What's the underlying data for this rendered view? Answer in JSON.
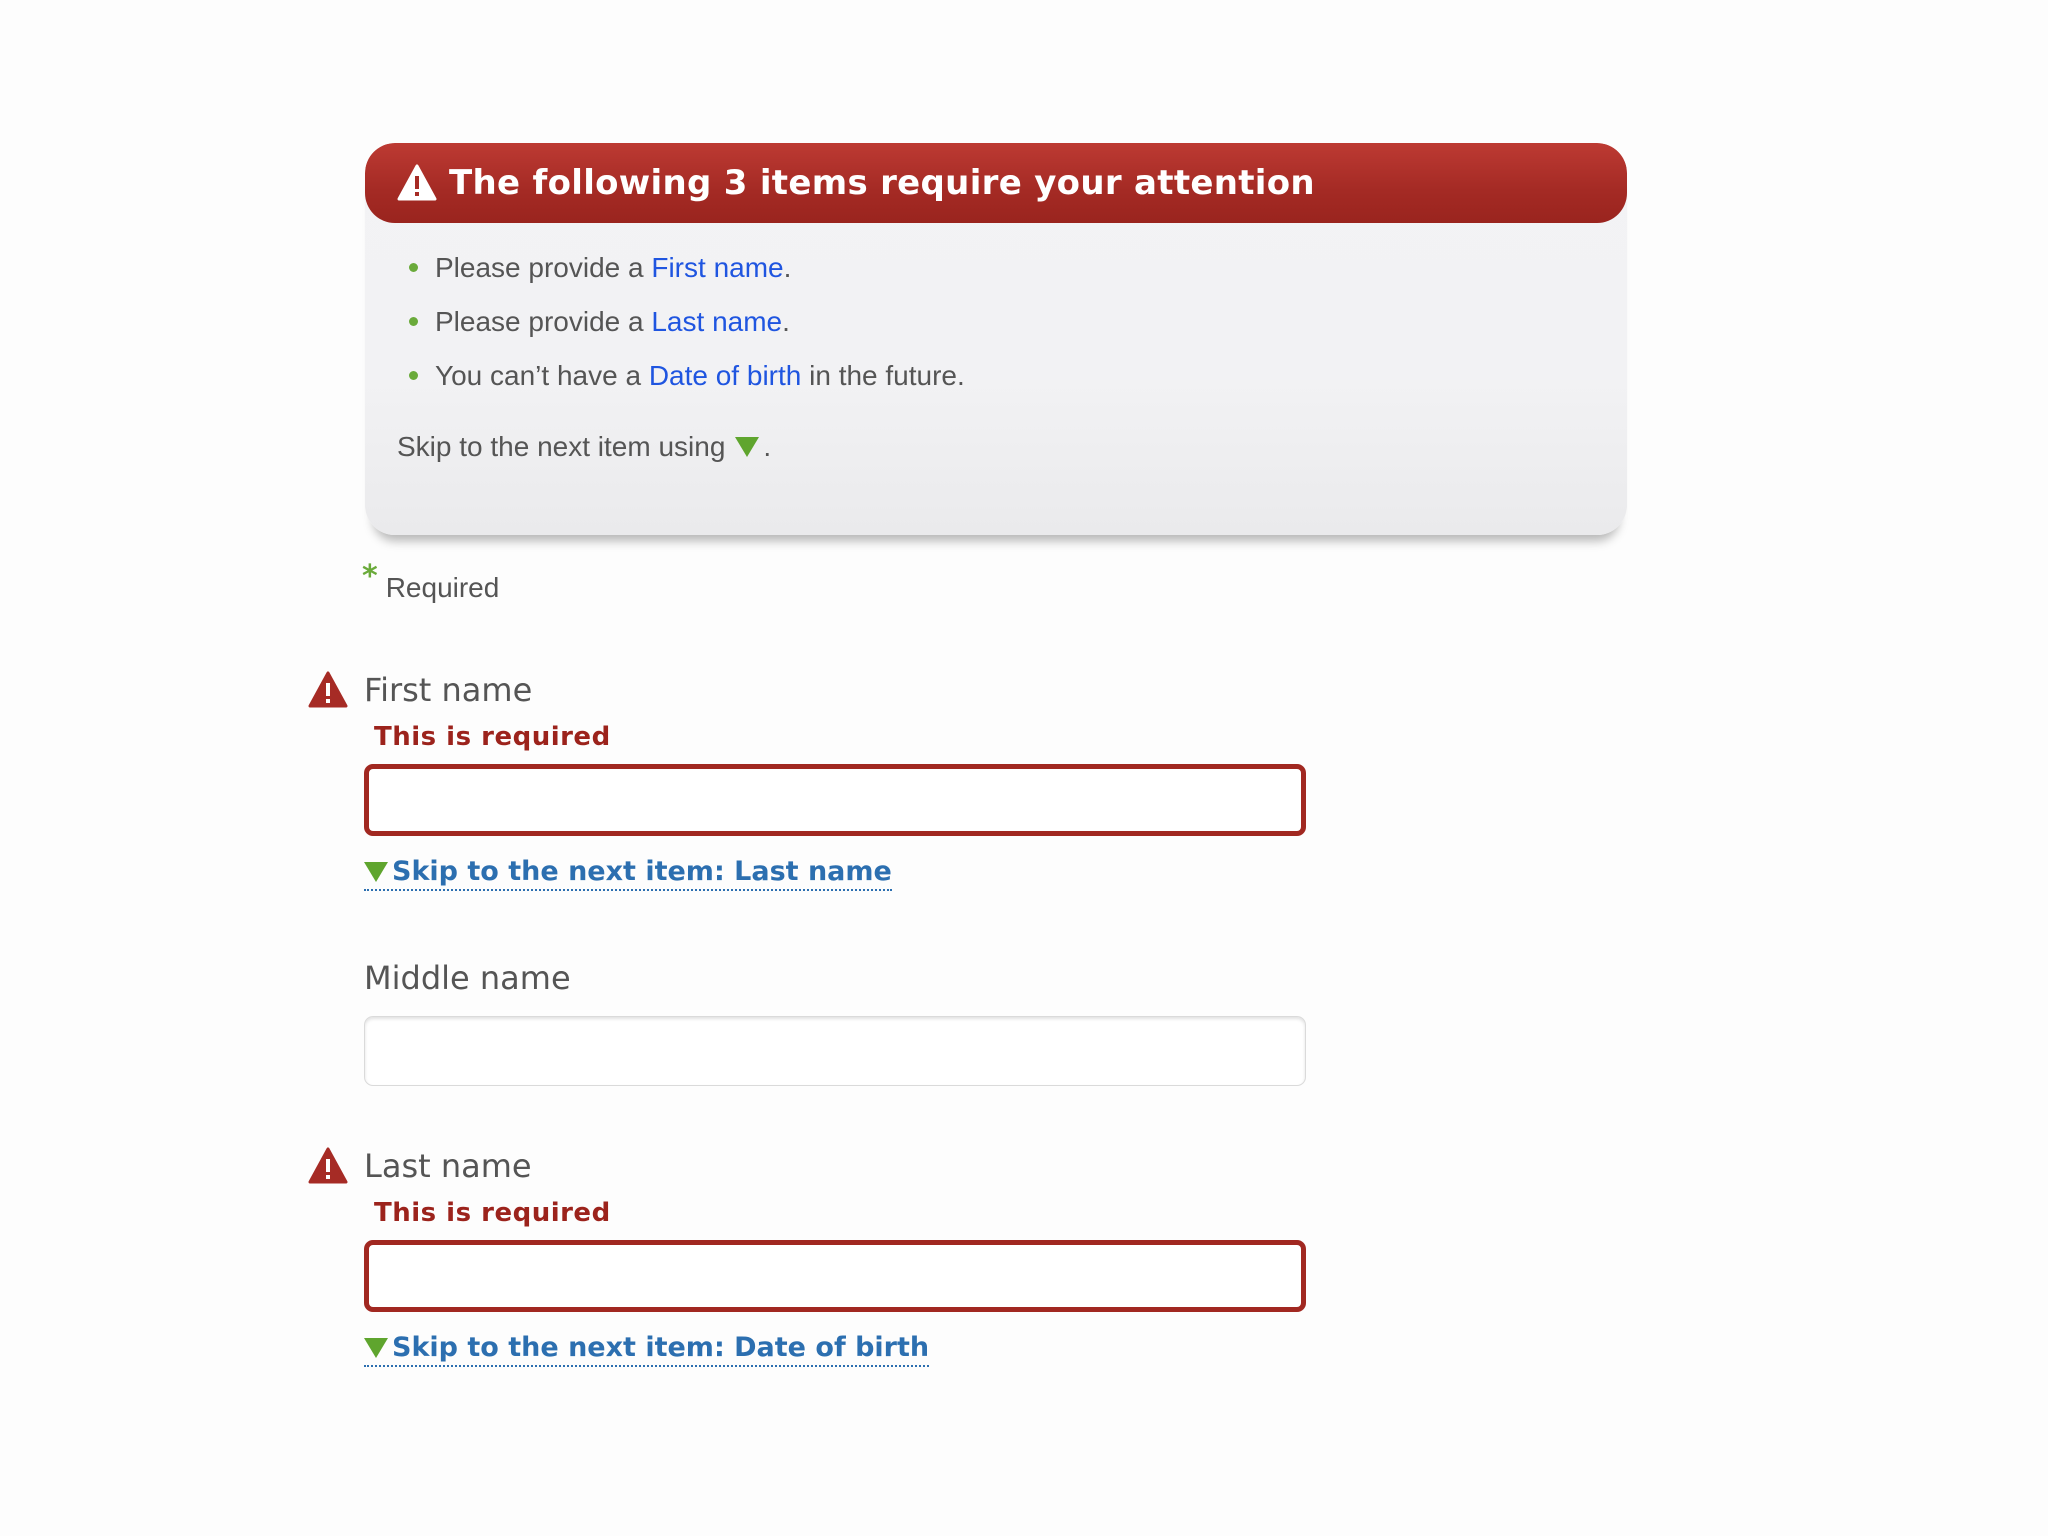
{
  "summary": {
    "title": "The following 3 items require your attention",
    "items": [
      {
        "prefix": "Please provide a ",
        "link": "First name",
        "suffix": "."
      },
      {
        "prefix": "Please provide a ",
        "link": "Last name",
        "suffix": "."
      },
      {
        "prefix": "You can’t have a ",
        "link": "Date of birth",
        "suffix": " in the future."
      }
    ],
    "skip_note_prefix": "Skip to the next item using",
    "skip_note_suffix": "."
  },
  "required": {
    "star": "*",
    "label": "Required"
  },
  "fields": {
    "first_name": {
      "label": "First name",
      "error": "This is required",
      "value": "",
      "skip_link": "Skip to the next item: Last name"
    },
    "middle_name": {
      "label": "Middle name",
      "value": ""
    },
    "last_name": {
      "label": "Last name",
      "error": "This is required",
      "value": "",
      "skip_link": "Skip to the next item: Date of birth"
    }
  },
  "colors": {
    "error_red": "#a12821",
    "link_blue": "#1f55e0",
    "skip_blue": "#2c6fb0",
    "accent_green": "#5fa52e"
  },
  "icons": {
    "warning": "warning-icon",
    "skip": "down-triangle-icon"
  }
}
